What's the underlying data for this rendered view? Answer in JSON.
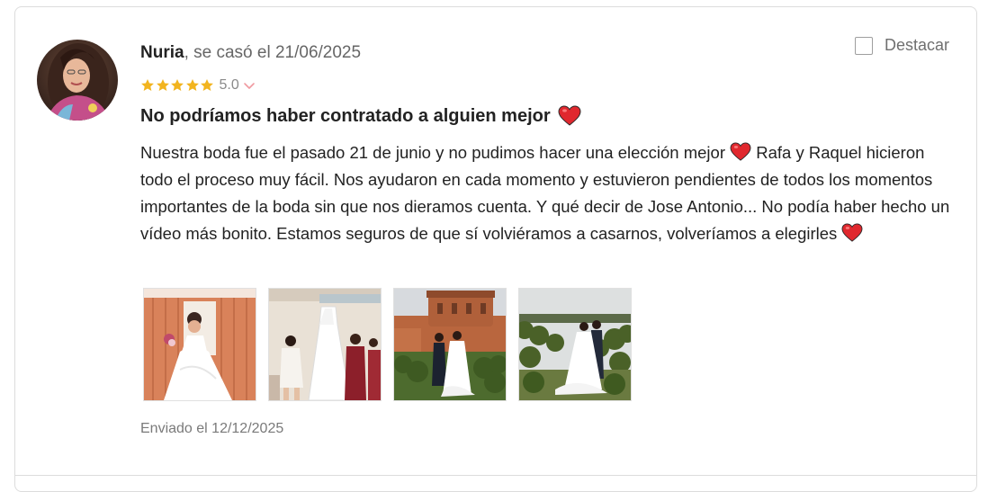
{
  "review": {
    "author": "Nuria",
    "married_text": ", se casó el 21/06/2025",
    "rating": "5.0",
    "stars": 5,
    "title": "No podríamos haber contratado a alguien mejor",
    "body_1": "Nuestra boda fue el pasado 21 de junio y no pudimos hacer una elección mejor",
    "body_2": " Rafa y Raquel hicieron todo el proceso muy fácil. Nos ayudaron en cada momento y estuvieron pendientes de todos los momentos importantes de la boda sin que nos dieramos cuenta. Y qué decir de Jose Antonio... No podía haber hecho un vídeo más bonito. Estamos seguros de que sí volviéramos a casarnos, volveríamos a elegirles",
    "sent": "Enviado el 12/12/2025"
  },
  "destacar": {
    "label": "Destacar",
    "checked": false
  },
  "colors": {
    "star": "#f2b41f",
    "heart": "#e0282e",
    "border": "#dcdcdc",
    "muted_text": "#7a7a7a"
  },
  "icons": {
    "star": "star-icon",
    "heart": "heart-emoji-icon",
    "chevron": "chevron-down-icon"
  }
}
